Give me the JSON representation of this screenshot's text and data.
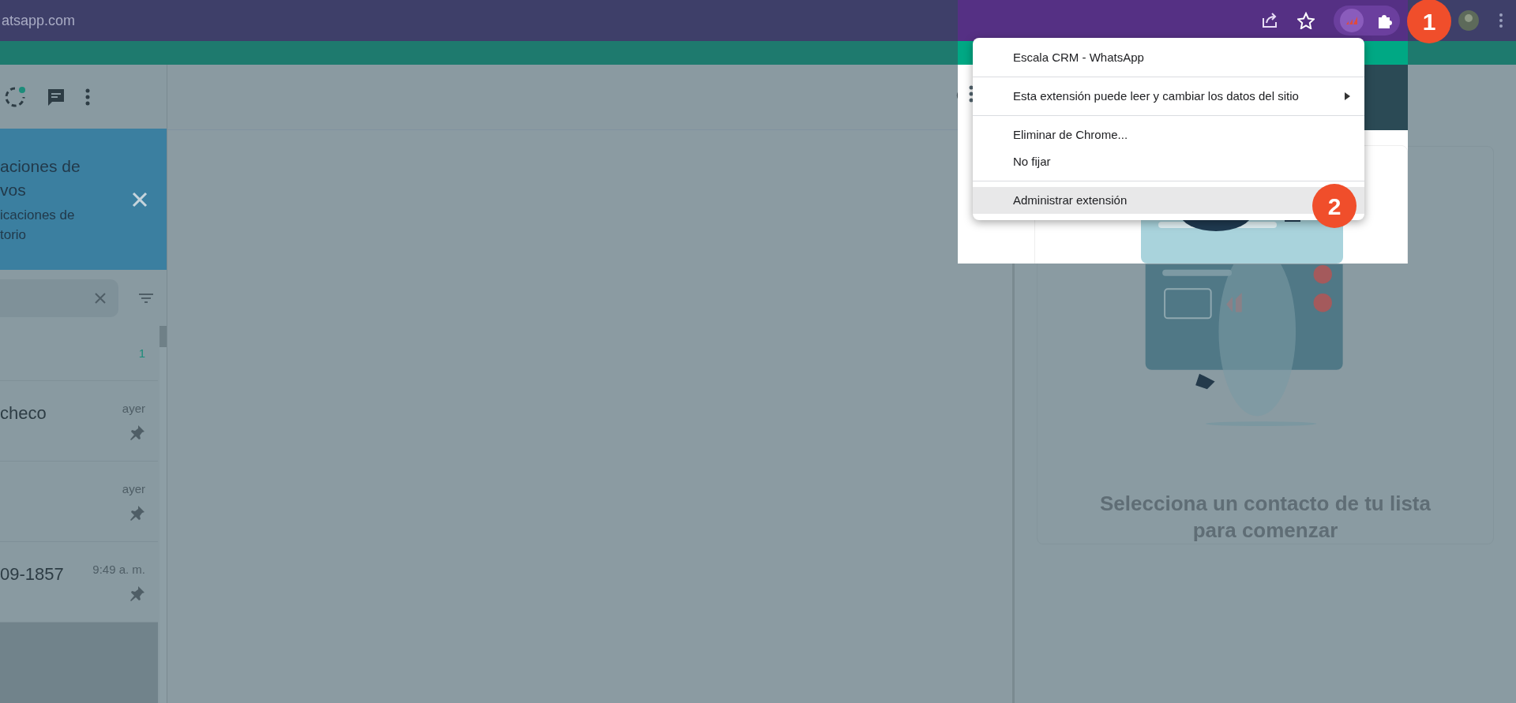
{
  "browser": {
    "address": "atsapp.com"
  },
  "sidebar": {
    "banner": {
      "title_lines": [
        "aciones de",
        "vos"
      ],
      "subtitle_lines": [
        "icaciones de",
        "torio"
      ]
    },
    "chats": [
      {
        "unread": "1",
        "pinned": false,
        "selected": false
      },
      {
        "name": "checo",
        "time": "ayer",
        "pinned": true,
        "selected": false
      },
      {
        "time": "ayer",
        "pinned": true,
        "selected": false
      },
      {
        "name": "09-1857",
        "time": "9:49 a. m.",
        "pinned": true,
        "selected": false
      },
      {
        "pinned": false,
        "selected": true
      }
    ]
  },
  "empty_state": {
    "message": "Selecciona un contacto de tu lista para comenzar"
  },
  "context_menu": {
    "items": [
      {
        "kind": "item",
        "label": "Escala CRM - WhatsApp",
        "submenu": false,
        "selected": false
      },
      {
        "kind": "separator"
      },
      {
        "kind": "item",
        "label": "Esta extensión puede leer y cambiar los datos del sitio",
        "submenu": true,
        "selected": false
      },
      {
        "kind": "separator"
      },
      {
        "kind": "item",
        "label": "Eliminar de Chrome...",
        "submenu": false,
        "selected": false
      },
      {
        "kind": "item",
        "label": "No fijar",
        "submenu": false,
        "selected": false
      },
      {
        "kind": "separator"
      },
      {
        "kind": "item",
        "label": "Administrar extensión",
        "submenu": false,
        "selected": true
      }
    ]
  },
  "step_badges": [
    {
      "label": "1"
    },
    {
      "label": "2"
    }
  ]
}
